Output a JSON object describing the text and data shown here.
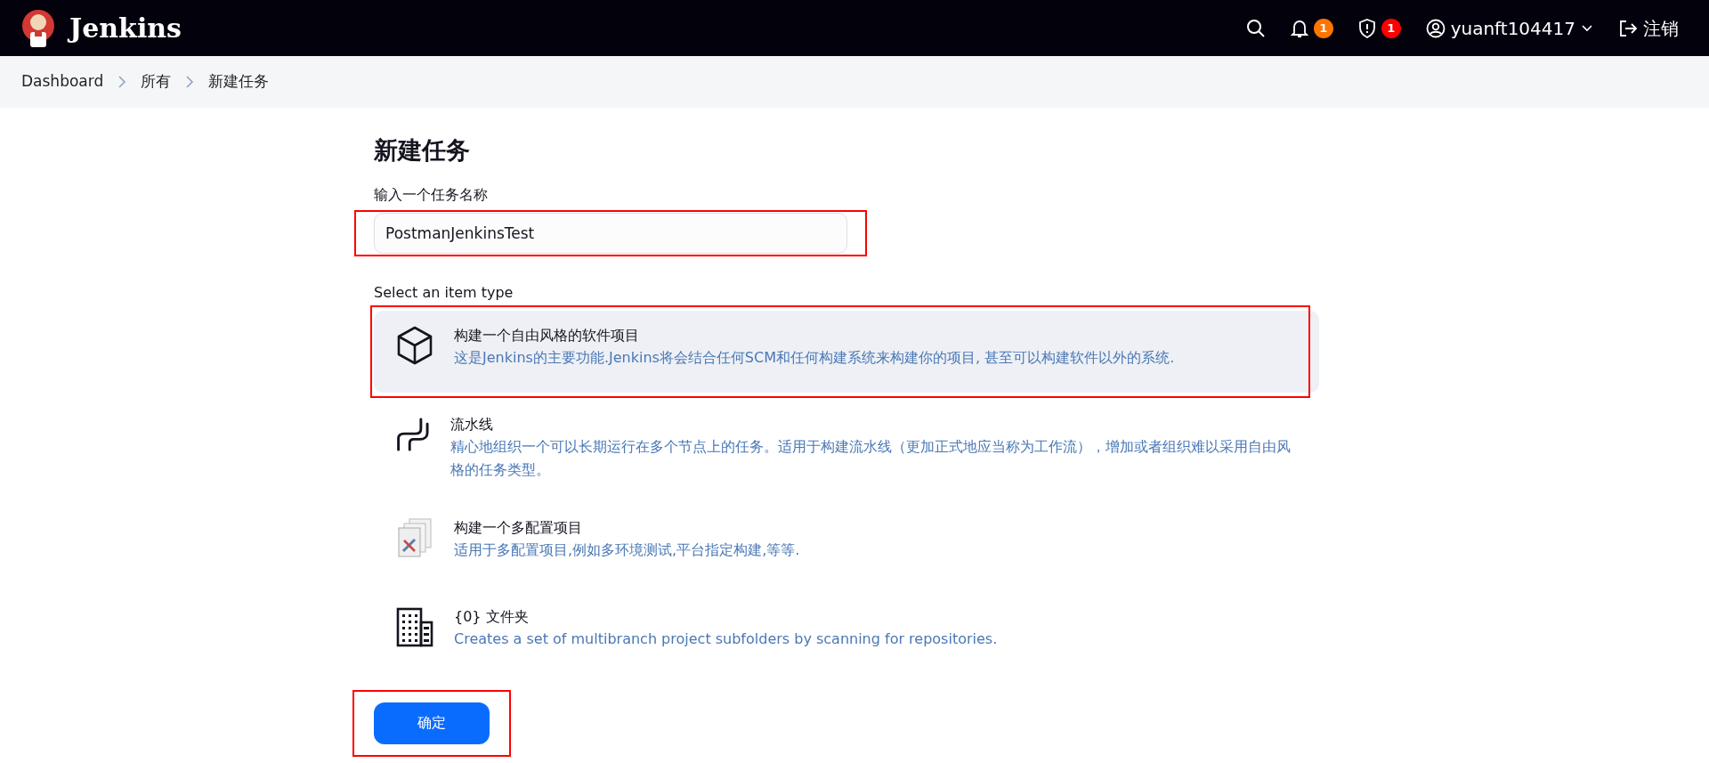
{
  "header": {
    "brand": "Jenkins",
    "notifications": {
      "count": "1"
    },
    "security": {
      "count": "1"
    },
    "user": "yuanft104417",
    "logout": "注销"
  },
  "breadcrumbs": [
    "Dashboard",
    "所有",
    "新建任务"
  ],
  "page_title": "新建任务",
  "name_field": {
    "label": "输入一个任务名称",
    "value": "PostmanJenkinsTest",
    "highlighted": true
  },
  "item_type_label": "Select an item type",
  "item_types": [
    {
      "kind": "freestyle",
      "title": "构建一个自由风格的软件项目",
      "description": "这是Jenkins的主要功能.Jenkins将会结合任何SCM和任何构建系统来构建你的项目, 甚至可以构建软件以外的系统.",
      "selected": true,
      "highlighted": true
    },
    {
      "kind": "pipeline",
      "title": "流水线",
      "description": "精心地组织一个可以长期运行在多个节点上的任务。适用于构建流水线（更加正式地应当称为工作流），增加或者组织难以采用自由风格的任务类型。",
      "selected": false,
      "highlighted": false
    },
    {
      "kind": "multiconfig",
      "title": "构建一个多配置项目",
      "description": "适用于多配置项目,例如多环境测试,平台指定构建,等等.",
      "selected": false,
      "highlighted": false
    },
    {
      "kind": "folder",
      "title": "{0} 文件夹",
      "description": "Creates a set of multibranch project subfolders by scanning for repositories.",
      "selected": false,
      "highlighted": false
    }
  ],
  "submit_button": {
    "label": "确定",
    "highlighted": true
  }
}
